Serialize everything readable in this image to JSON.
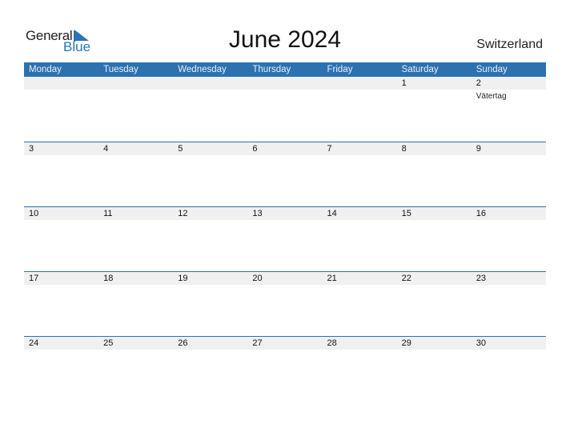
{
  "logo": {
    "word1": "General",
    "word2": "Blue"
  },
  "title": "June 2024",
  "country": "Switzerland",
  "weekdays": [
    "Monday",
    "Tuesday",
    "Wednesday",
    "Thursday",
    "Friday",
    "Saturday",
    "Sunday"
  ],
  "weeks": [
    [
      "",
      "",
      "",
      "",
      "",
      "1",
      "2"
    ],
    [
      "3",
      "4",
      "5",
      "6",
      "7",
      "8",
      "9"
    ],
    [
      "10",
      "11",
      "12",
      "13",
      "14",
      "15",
      "16"
    ],
    [
      "17",
      "18",
      "19",
      "20",
      "21",
      "22",
      "23"
    ],
    [
      "24",
      "25",
      "26",
      "27",
      "28",
      "29",
      "30"
    ]
  ],
  "holidays": {
    "week0_day6": "Vätertag"
  },
  "colors": {
    "accent": "#2c71b0",
    "date_band": "#f0f0f0"
  }
}
